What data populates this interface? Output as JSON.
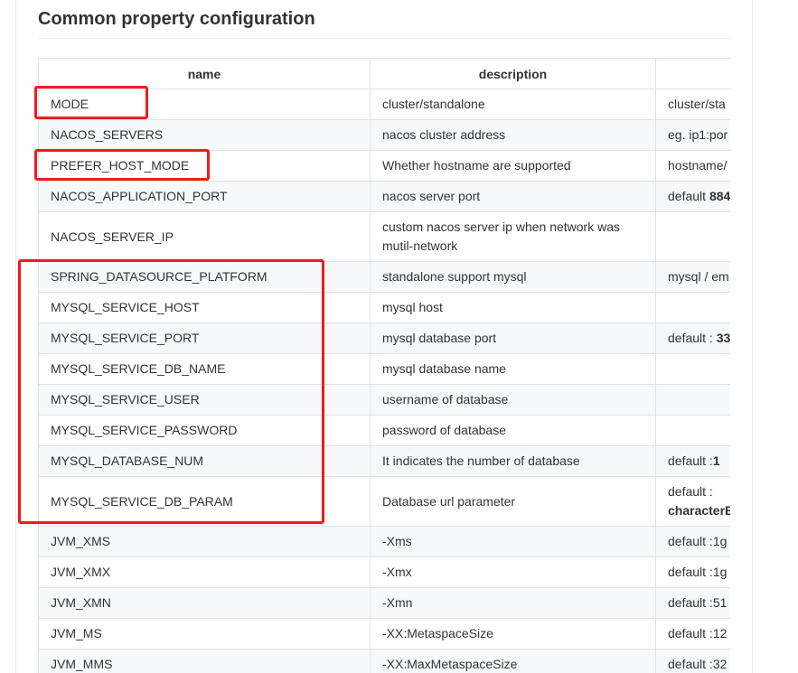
{
  "section": {
    "title": "Common property configuration"
  },
  "table": {
    "headers": [
      "name",
      "description",
      ""
    ],
    "rows": [
      {
        "name": "MODE",
        "description": "cluster/standalone",
        "value": "cluster/sta",
        "value_bold": ""
      },
      {
        "name": "NACOS_SERVERS",
        "description": "nacos cluster address",
        "value": "eg. ip1:por",
        "value_bold": ""
      },
      {
        "name": "PREFER_HOST_MODE",
        "description": "Whether hostname are supported",
        "value": "hostname/",
        "value_bold": ""
      },
      {
        "name": "NACOS_APPLICATION_PORT",
        "description": "nacos server port",
        "value": "default ",
        "value_bold": "884"
      },
      {
        "name": "NACOS_SERVER_IP",
        "description": "custom nacos server ip when network was mutil-network",
        "value": "",
        "value_bold": ""
      },
      {
        "name": "SPRING_DATASOURCE_PLATFORM",
        "description": "standalone support mysql",
        "value": "mysql / em",
        "value_bold": ""
      },
      {
        "name": "MYSQL_SERVICE_HOST",
        "description": "mysql host",
        "value": "",
        "value_bold": ""
      },
      {
        "name": "MYSQL_SERVICE_PORT",
        "description": "mysql database port",
        "value": "default : ",
        "value_bold": "33"
      },
      {
        "name": "MYSQL_SERVICE_DB_NAME",
        "description": "mysql database name",
        "value": "",
        "value_bold": ""
      },
      {
        "name": "MYSQL_SERVICE_USER",
        "description": "username of database",
        "value": "",
        "value_bold": ""
      },
      {
        "name": "MYSQL_SERVICE_PASSWORD",
        "description": "password of database",
        "value": "",
        "value_bold": ""
      },
      {
        "name": "MYSQL_DATABASE_NUM",
        "description": "It indicates the number of database",
        "value": "default :",
        "value_bold": "1"
      },
      {
        "name": "MYSQL_SERVICE_DB_PARAM",
        "description": "Database url parameter",
        "value": "default :",
        "value_bold": "characterE"
      },
      {
        "name": "JVM_XMS",
        "description": "-Xms",
        "value": "default :1g",
        "value_bold": ""
      },
      {
        "name": "JVM_XMX",
        "description": "-Xmx",
        "value": "default :1g",
        "value_bold": ""
      },
      {
        "name": "JVM_XMN",
        "description": "-Xmn",
        "value": "default :51",
        "value_bold": ""
      },
      {
        "name": "JVM_MS",
        "description": "-XX:MetaspaceSize",
        "value": "default :12",
        "value_bold": ""
      },
      {
        "name": "JVM_MMS",
        "description": "-XX:MaxMetaspaceSize",
        "value": "default :32",
        "value_bold": ""
      }
    ]
  },
  "annotations": {
    "color": "#ee1c1c"
  }
}
